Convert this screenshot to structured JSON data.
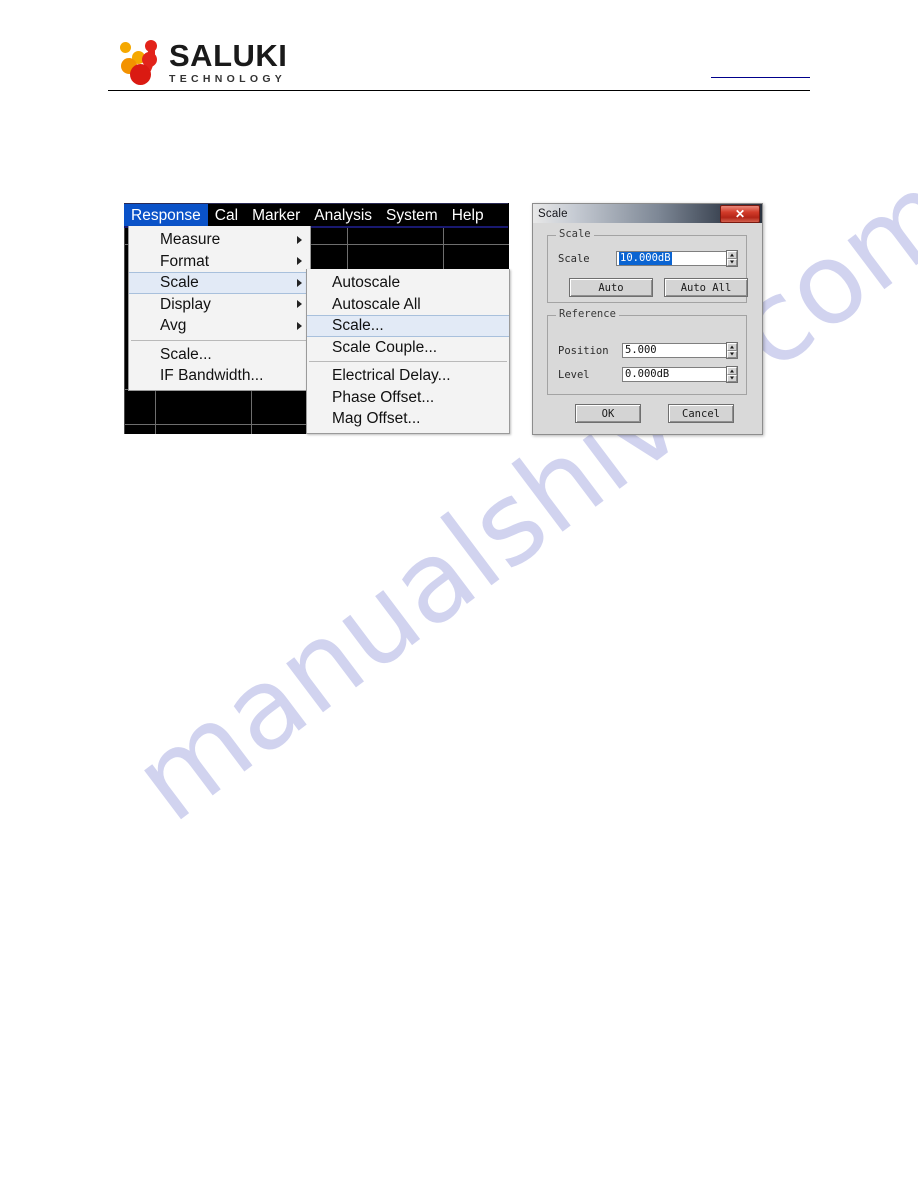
{
  "header": {
    "logo_name": "SALUKI",
    "logo_sub": "TECHNOLOGY"
  },
  "watermark": {
    "text": "manualshive.com"
  },
  "vna": {
    "menubar": [
      {
        "label": "Response",
        "active": true
      },
      {
        "label": "Cal",
        "active": false
      },
      {
        "label": "Marker",
        "active": false
      },
      {
        "label": "Analysis",
        "active": false
      },
      {
        "label": "System",
        "active": false
      },
      {
        "label": "Help",
        "active": false
      }
    ],
    "response_menu": [
      {
        "label": "Measure",
        "submenu": true,
        "sep_after": false
      },
      {
        "label": "Format",
        "submenu": true,
        "sep_after": false
      },
      {
        "label": "Scale",
        "submenu": true,
        "highlight": true,
        "sep_after": false
      },
      {
        "label": "Display",
        "submenu": true,
        "sep_after": false
      },
      {
        "label": "Avg",
        "submenu": true,
        "sep_after": true
      },
      {
        "label": "Scale...",
        "submenu": false,
        "sep_after": false
      },
      {
        "label": "IF Bandwidth...",
        "submenu": false,
        "sep_after": false
      }
    ],
    "scale_submenu": [
      {
        "label": "Autoscale",
        "sep_after": false
      },
      {
        "label": "Autoscale All",
        "sep_after": false
      },
      {
        "label": "Scale...",
        "highlight": true,
        "sep_after": false
      },
      {
        "label": "Scale Couple...",
        "sep_after": true
      },
      {
        "label": "Electrical Delay...",
        "sep_after": false
      },
      {
        "label": "Phase Offset...",
        "sep_after": false
      },
      {
        "label": "Mag Offset...",
        "sep_after": false
      }
    ]
  },
  "dialog": {
    "title": "Scale",
    "close_label": "✕",
    "scale_group": {
      "legend": "Scale",
      "scale_label": "Scale",
      "scale_value": "10.000dB",
      "auto_label": "Auto",
      "auto_all_label": "Auto All"
    },
    "reference_group": {
      "legend": "Reference",
      "position_label": "Position",
      "position_value": "5.000",
      "level_label": "Level",
      "level_value": "0.000dB"
    },
    "ok_label": "OK",
    "cancel_label": "Cancel"
  },
  "colors": {
    "menu_accent": "#0A52C8",
    "selection_blue": "#0A64D2",
    "logo_red": "#E2231A",
    "logo_orange": "#F5A800",
    "close_red": "#D33C2A",
    "watermark": "#c9cced"
  }
}
